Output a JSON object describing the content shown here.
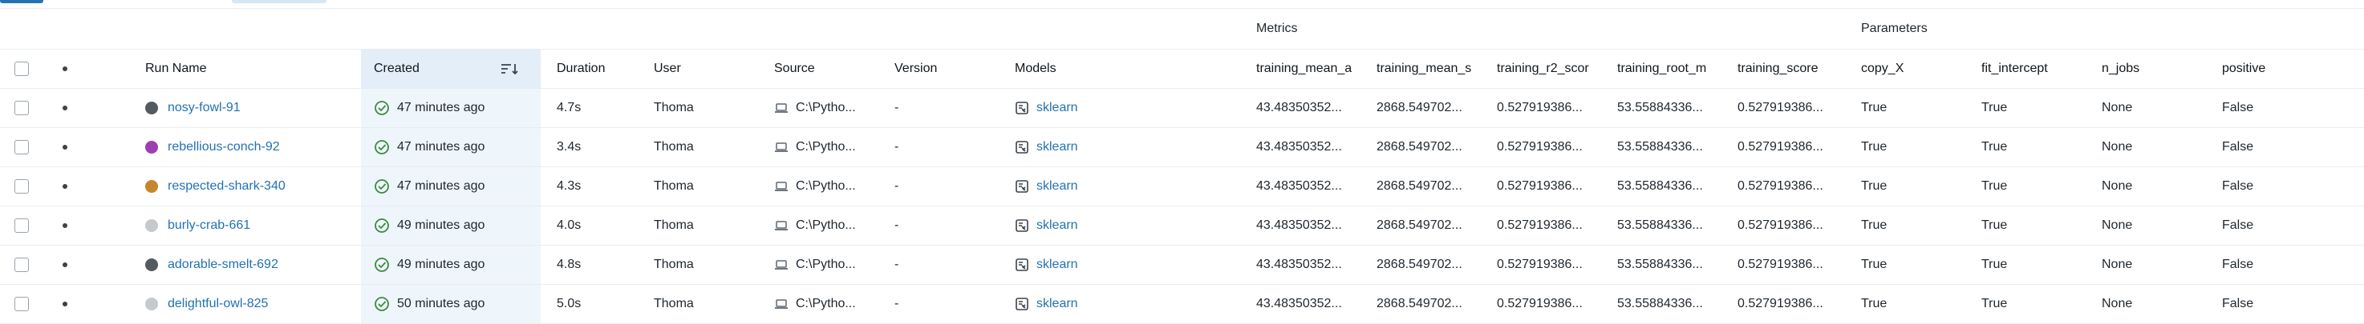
{
  "groups": {
    "metrics": "Metrics",
    "parameters": "Parameters"
  },
  "headers": {
    "run_name": "Run Name",
    "created": "Created",
    "duration": "Duration",
    "user": "User",
    "source": "Source",
    "version": "Version",
    "models": "Models",
    "metric_cols": [
      "training_mean_a",
      "training_mean_s",
      "training_r2_scor",
      "training_root_m",
      "training_score"
    ],
    "param_cols": [
      "copy_X",
      "fit_intercept",
      "n_jobs",
      "positive"
    ]
  },
  "colors": {
    "accent": "#2272b4",
    "success": "#3d8b40"
  },
  "rows": [
    {
      "name": "nosy-fowl-91",
      "color": "#555a5f",
      "created": "47 minutes ago",
      "duration": "4.7s",
      "user": "Thoma",
      "source": "C:\\Pytho...",
      "version": "-",
      "model": "sklearn",
      "metrics": [
        "43.48350352...",
        "2868.549702...",
        "0.527919386...",
        "53.55884336...",
        "0.527919386..."
      ],
      "params": [
        "True",
        "True",
        "None",
        "False"
      ]
    },
    {
      "name": "rebellious-conch-92",
      "color": "#9c3fb5",
      "created": "47 minutes ago",
      "duration": "3.4s",
      "user": "Thoma",
      "source": "C:\\Pytho...",
      "version": "-",
      "model": "sklearn",
      "metrics": [
        "43.48350352...",
        "2868.549702...",
        "0.527919386...",
        "53.55884336...",
        "0.527919386..."
      ],
      "params": [
        "True",
        "True",
        "None",
        "False"
      ]
    },
    {
      "name": "respected-shark-340",
      "color": "#c7852c",
      "created": "47 minutes ago",
      "duration": "4.3s",
      "user": "Thoma",
      "source": "C:\\Pytho...",
      "version": "-",
      "model": "sklearn",
      "metrics": [
        "43.48350352...",
        "2868.549702...",
        "0.527919386...",
        "53.55884336...",
        "0.527919386..."
      ],
      "params": [
        "True",
        "True",
        "None",
        "False"
      ]
    },
    {
      "name": "burly-crab-661",
      "color": "#c6c9cc",
      "created": "49 minutes ago",
      "duration": "4.0s",
      "user": "Thoma",
      "source": "C:\\Pytho...",
      "version": "-",
      "model": "sklearn",
      "metrics": [
        "43.48350352...",
        "2868.549702...",
        "0.527919386...",
        "53.55884336...",
        "0.527919386..."
      ],
      "params": [
        "True",
        "True",
        "None",
        "False"
      ]
    },
    {
      "name": "adorable-smelt-692",
      "color": "#555a5f",
      "created": "49 minutes ago",
      "duration": "4.8s",
      "user": "Thoma",
      "source": "C:\\Pytho...",
      "version": "-",
      "model": "sklearn",
      "metrics": [
        "43.48350352...",
        "2868.549702...",
        "0.527919386...",
        "53.55884336...",
        "0.527919386..."
      ],
      "params": [
        "True",
        "True",
        "None",
        "False"
      ]
    },
    {
      "name": "delightful-owl-825",
      "color": "#c6c9cc",
      "created": "50 minutes ago",
      "duration": "5.0s",
      "user": "Thoma",
      "source": "C:\\Pytho...",
      "version": "-",
      "model": "sklearn",
      "metrics": [
        "43.48350352...",
        "2868.549702...",
        "0.527919386...",
        "53.55884336...",
        "0.527919386..."
      ],
      "params": [
        "True",
        "True",
        "None",
        "False"
      ]
    }
  ]
}
